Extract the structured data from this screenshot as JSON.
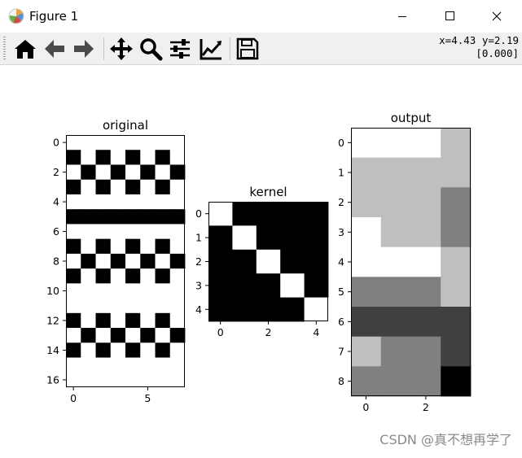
{
  "window": {
    "title": "Figure 1",
    "logo_icon": "matplotlib-logo-icon",
    "controls": [
      "minimize-icon",
      "maximize-icon",
      "close-icon"
    ]
  },
  "toolbar": {
    "tools": [
      "home-icon",
      "back-arrow-icon",
      "forward-arrow-icon",
      "pan-icon",
      "zoom-icon",
      "subplots-config-icon",
      "edit-axes-icon",
      "save-icon"
    ],
    "coords_line1": "x=4.43 y=2.19",
    "coords_line2": "[0.000]"
  },
  "watermark": "CSDN @真不想再学了",
  "chart_data": [
    {
      "type": "heatmap",
      "title": "original",
      "cmap": "gray",
      "xticks": [
        0,
        5
      ],
      "yticks": [
        0,
        2,
        4,
        6,
        8,
        10,
        12,
        14,
        16
      ],
      "values": [
        [
          1,
          1,
          1,
          1,
          1,
          1,
          1,
          1
        ],
        [
          0,
          1,
          0,
          1,
          0,
          1,
          0,
          1
        ],
        [
          1,
          0,
          1,
          0,
          1,
          0,
          1,
          0
        ],
        [
          0,
          1,
          0,
          1,
          0,
          1,
          0,
          1
        ],
        [
          1,
          1,
          1,
          1,
          1,
          1,
          1,
          1
        ],
        [
          0,
          0,
          0,
          0,
          0,
          0,
          0,
          0
        ],
        [
          1,
          1,
          1,
          1,
          1,
          1,
          1,
          1
        ],
        [
          0,
          1,
          0,
          1,
          0,
          1,
          0,
          1
        ],
        [
          1,
          0,
          1,
          0,
          1,
          0,
          1,
          0
        ],
        [
          0,
          1,
          0,
          1,
          0,
          1,
          0,
          1
        ],
        [
          1,
          1,
          1,
          1,
          1,
          1,
          1,
          1
        ],
        [
          1,
          1,
          1,
          1,
          1,
          1,
          1,
          1
        ],
        [
          0,
          1,
          0,
          1,
          0,
          1,
          0,
          1
        ],
        [
          1,
          0,
          1,
          0,
          1,
          0,
          1,
          0
        ],
        [
          0,
          1,
          0,
          1,
          0,
          1,
          0,
          1
        ],
        [
          1,
          1,
          1,
          1,
          1,
          1,
          1,
          1
        ],
        [
          1,
          1,
          1,
          1,
          1,
          1,
          1,
          1
        ]
      ]
    },
    {
      "type": "heatmap",
      "title": "kernel",
      "cmap": "gray",
      "xticks": [
        0,
        2,
        4
      ],
      "yticks": [
        0,
        1,
        2,
        3,
        4
      ],
      "values": [
        [
          1,
          0,
          0,
          0,
          0
        ],
        [
          0,
          1,
          0,
          0,
          0
        ],
        [
          0,
          0,
          1,
          0,
          0
        ],
        [
          0,
          0,
          0,
          1,
          0
        ],
        [
          0,
          0,
          0,
          0,
          1
        ]
      ]
    },
    {
      "type": "heatmap",
      "title": "output",
      "cmap": "gray",
      "xticks": [
        0,
        2
      ],
      "yticks": [
        0,
        1,
        2,
        3,
        4,
        5,
        6,
        7,
        8
      ],
      "values": [
        [
          1,
          1,
          1,
          0.75
        ],
        [
          0.75,
          0.75,
          0.75,
          0.75
        ],
        [
          0.75,
          0.75,
          0.75,
          0.5
        ],
        [
          1,
          0.75,
          0.75,
          0.5
        ],
        [
          1,
          1,
          1,
          0.75
        ],
        [
          0.5,
          0.5,
          0.5,
          0.75
        ],
        [
          0.25,
          0.25,
          0.25,
          0.25
        ],
        [
          0.75,
          0.5,
          0.5,
          0.25
        ],
        [
          0.5,
          0.5,
          0.5,
          0
        ]
      ]
    }
  ]
}
